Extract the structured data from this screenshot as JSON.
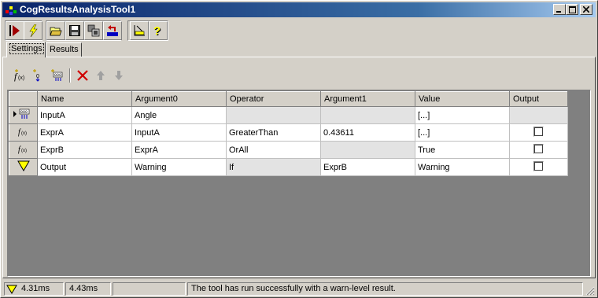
{
  "window": {
    "title": "CogResultsAnalysisTool1",
    "controls": [
      "minimize",
      "maximize",
      "close"
    ]
  },
  "toolbar": {
    "buttons": [
      {
        "name": "run-icon"
      },
      {
        "name": "electric-icon"
      },
      {
        "name": "open-folder-icon"
      },
      {
        "name": "save-disk-icon"
      },
      {
        "name": "copy-images-icon"
      },
      {
        "name": "reset-icon"
      },
      {
        "name": "measure-icon"
      },
      {
        "name": "help-icon"
      }
    ]
  },
  "tabs": [
    {
      "label": "Settings",
      "active": true
    },
    {
      "label": "Results",
      "active": false
    }
  ],
  "sub_toolbar": {
    "buttons": [
      "add-expression-icon",
      "add-input-icon",
      "add-output-icon",
      "delete-icon",
      "move-up-icon",
      "move-down-icon"
    ]
  },
  "grid": {
    "columns": [
      "Name",
      "Argument0",
      "Operator",
      "Argument1",
      "Value",
      "Output"
    ],
    "rows": [
      {
        "icon": "input-icon",
        "selected": true,
        "name": "InputA",
        "arg0": "Angle",
        "operator": "",
        "arg1": "",
        "value": "[...]",
        "output": null
      },
      {
        "icon": "function-icon",
        "selected": false,
        "name": "ExprA",
        "arg0": "InputA",
        "operator": "GreaterThan",
        "arg1": "0.43611",
        "value": "[...]",
        "output": false
      },
      {
        "icon": "function-icon",
        "selected": false,
        "name": "ExprB",
        "arg0": "ExprA",
        "operator": "OrAll",
        "arg1": "",
        "value": "True",
        "output": false
      },
      {
        "icon": "warning-triangle-icon",
        "selected": false,
        "name": "Output",
        "arg0": "Warning",
        "operator": "If",
        "arg1": "ExprB",
        "value": "Warning",
        "output": false
      }
    ]
  },
  "status": {
    "icon": "warning-triangle-icon",
    "time1": "4.31ms",
    "time2": "4.43ms",
    "empty": "",
    "message": "The tool has run successfully with a warn-level result."
  }
}
